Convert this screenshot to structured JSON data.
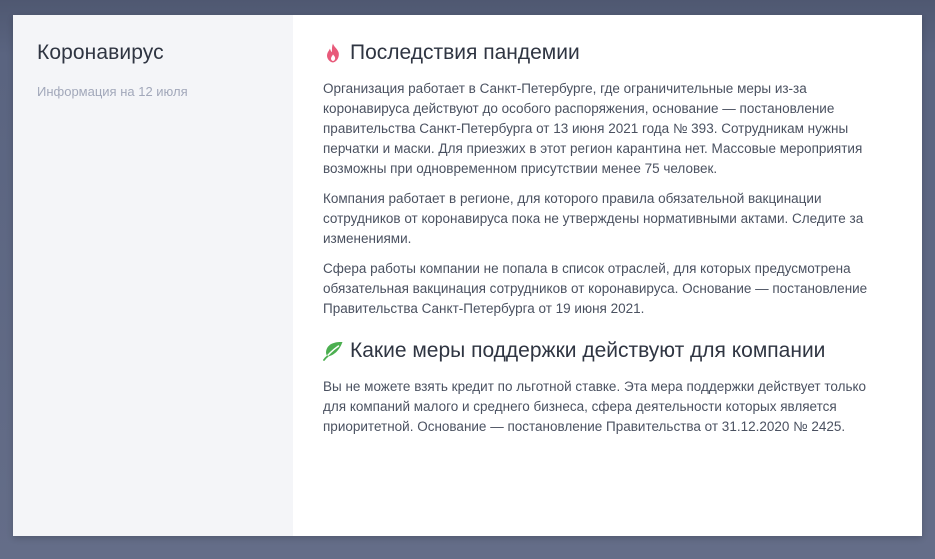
{
  "sidebar": {
    "title": "Коронавирус",
    "subtitle": "Информация на 12 июля"
  },
  "sections": [
    {
      "icon": "fire-icon",
      "icon_color": "#e85a7a",
      "heading": "Последствия пандемии",
      "paragraphs": [
        "Организация работает в Санкт-Петербурге, где ограничительные меры из-за коронавируса действуют до особого распоряжения, основание — постановление правительства Санкт-Петербурга от 13 июня 2021 года № 393. Сотрудникам нужны перчатки и маски. Для приезжих в этот регион карантина нет. Массовые мероприятия возможны при одновременном присутствии менее 75 человек.",
        "Компания работает в регионе, для которого правила обязательной вакцинации сотрудников от коронавируса пока не утверждены нормативными актами. Следите за изменениями.",
        "Сфера работы компании не попала в список отраслей, для которых предусмотрена обязательная вакцинация сотрудников от коронавируса. Основание — постановление Правительства Санкт-Петербурга от 19 июня 2021."
      ]
    },
    {
      "icon": "leaf-icon",
      "icon_color": "#4caf50",
      "heading": "Какие меры поддержки действуют для компании",
      "paragraphs": [
        "Вы не можете взять кредит по льготной ставке. Эта мера поддержки действует только для компаний малого и среднего бизнеса, сфера деятельности которых является приоритетной. Основание — постановление Правительства от 31.12.2020 № 2425."
      ]
    }
  ],
  "colors": {
    "backdrop": "#5a6480",
    "sidebar_bg": "#f4f5f8",
    "heading": "#2f3542",
    "body_text": "#4a5160",
    "muted": "#a2a8ba"
  }
}
